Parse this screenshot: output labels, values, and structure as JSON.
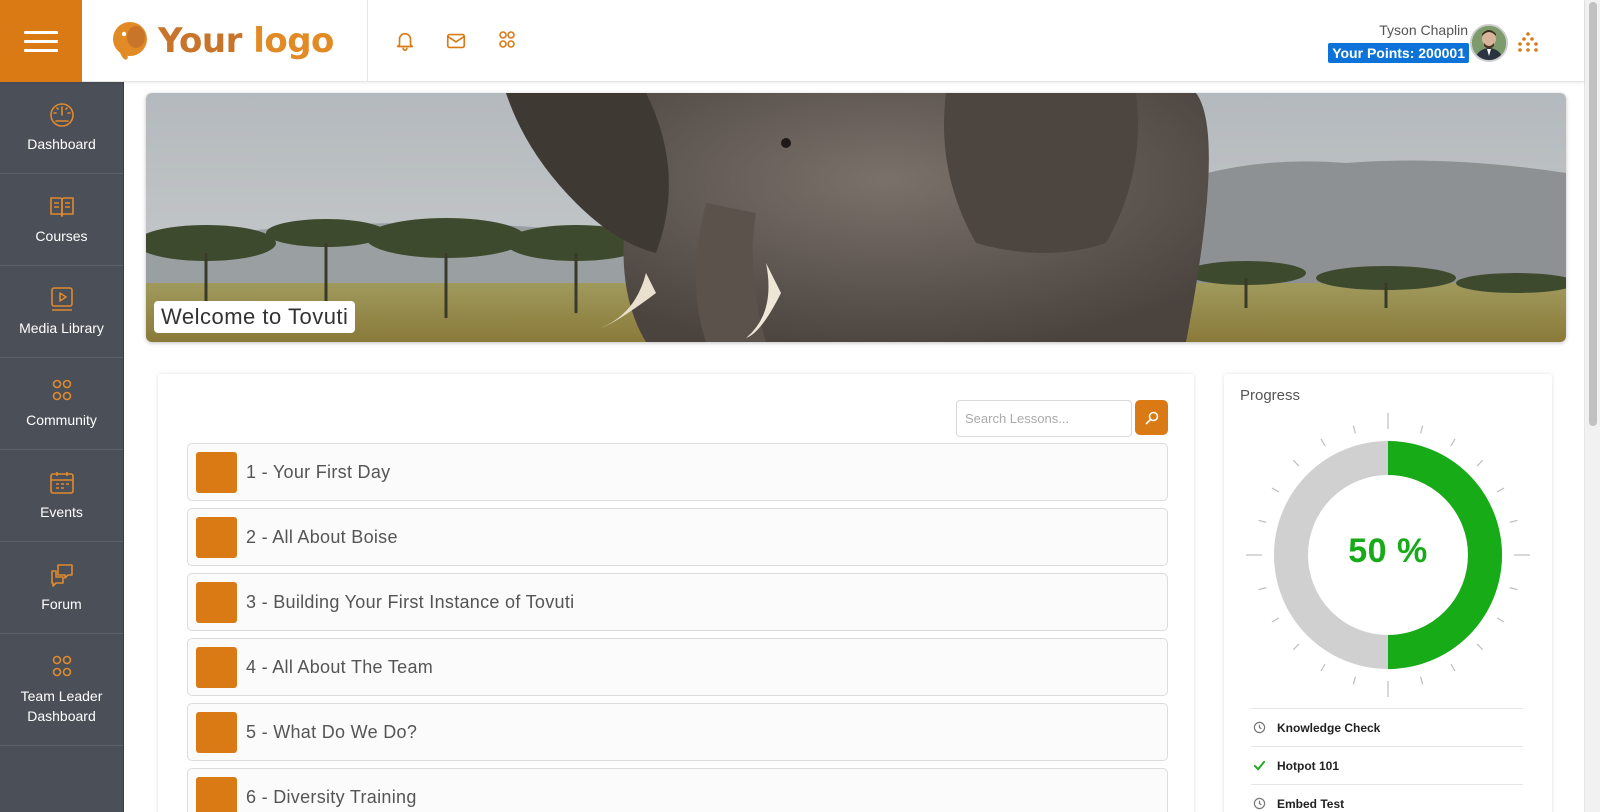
{
  "header": {
    "logo_your": "Your",
    "logo_word": "logo",
    "user_name": "Tyson Chaplin",
    "points_label": "Your Points: 200001"
  },
  "sidebar": {
    "items": [
      {
        "label": "Dashboard",
        "icon": "gauge-icon"
      },
      {
        "label": "Courses",
        "icon": "book-icon"
      },
      {
        "label": "Media Library",
        "icon": "media-icon"
      },
      {
        "label": "Community",
        "icon": "people-icon"
      },
      {
        "label": "Events",
        "icon": "calendar-icon"
      },
      {
        "label": "Forum",
        "icon": "chat-icon"
      },
      {
        "label": "Team Leader Dashboard",
        "icon": "team-icon"
      }
    ]
  },
  "banner": {
    "welcome": "Welcome to Tovuti"
  },
  "lessons": {
    "search_placeholder": "Search Lessons...",
    "items": [
      "1 - Your First Day",
      "2 - All About Boise",
      "3 - Building Your First Instance of Tovuti",
      "4 - All About The Team",
      "5 - What Do We Do?",
      "6 - Diversity Training"
    ]
  },
  "progress": {
    "title": "Progress",
    "percent": 50,
    "percent_label": "50 %",
    "items": [
      {
        "label": "Knowledge Check",
        "status": "clock-icon"
      },
      {
        "label": "Hotpot 101",
        "status": "check-icon"
      },
      {
        "label": "Embed Test",
        "status": "clock-icon"
      }
    ]
  },
  "colors": {
    "accent": "#d97a14",
    "sidebar": "#4b4f57",
    "points_bg": "#0d73d8",
    "progress_green": "#17ab17"
  }
}
